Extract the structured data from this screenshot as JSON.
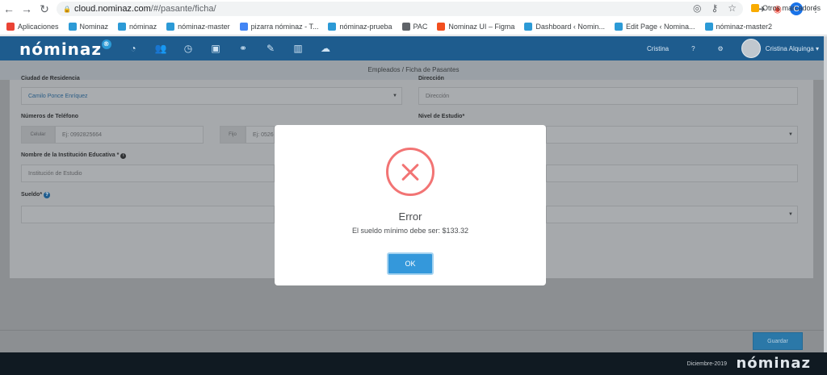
{
  "browser": {
    "url_host": "cloud.nominaz.com",
    "url_path": "/#/pasante/ficha/",
    "bookmarks": [
      {
        "label": "Aplicaciones",
        "color": "#ea4335"
      },
      {
        "label": "Nominaz",
        "color": "#2c9ad6"
      },
      {
        "label": "nóminaz",
        "color": "#2c9ad6"
      },
      {
        "label": "nóminaz-master",
        "color": "#2c9ad6"
      },
      {
        "label": "pizarra nóminaz - T...",
        "color": "#4285f4"
      },
      {
        "label": "nóminaz-prueba",
        "color": "#2c9ad6"
      },
      {
        "label": "PAC",
        "color": "#5f6368"
      },
      {
        "label": "Nominaz UI – Figma",
        "color": "#f24e1e"
      },
      {
        "label": "Dashboard ‹ Nomin...",
        "color": "#2c9ad6"
      },
      {
        "label": "Edit Page ‹ Nomina...",
        "color": "#2c9ad6"
      },
      {
        "label": "nóminaz-master2",
        "color": "#2c9ad6"
      }
    ],
    "other_bookmarks": "Otros marcadores",
    "profile_initial": "C"
  },
  "app": {
    "logo_text": "nóminaz",
    "user_short": "Cristina",
    "help": "?",
    "user_full": "Cristina Alquinga ▾",
    "breadcrumb": "Empleados / Ficha de Pasantes"
  },
  "form": {
    "city_label": "Ciudad de Residencia",
    "city_value": "Camilo Ponce Enríquez",
    "address_label": "Dirección",
    "address_placeholder": "Dirección",
    "phones_label": "Números de Teléfono",
    "mobile_addon": "Celular",
    "mobile_placeholder": "Ej: 0992825664",
    "fixed_addon": "Fijo",
    "fixed_placeholder": "Ej: 0526",
    "study_label": "Nivel de Estudio*",
    "institution_label": "Nombre de la Institución Educativa *",
    "institution_placeholder": "Institución de Estudio",
    "salary_label": "Sueldo*",
    "save_label": "Guardar"
  },
  "footer": {
    "period": "Diciembre-2019",
    "logo_text": "nóminaz"
  },
  "modal": {
    "title": "Error",
    "message": "El sueldo mínimo debe ser: $133.32",
    "ok_label": "OK"
  },
  "colors": {
    "header": "#1e5c8e",
    "error": "#f27474",
    "ok_button": "#3498db"
  }
}
